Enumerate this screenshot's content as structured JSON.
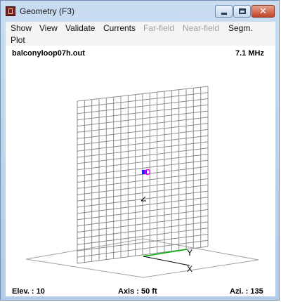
{
  "window": {
    "title": "Geometry   (F3)"
  },
  "menu": {
    "row1": [
      {
        "label": "Show",
        "disabled": false
      },
      {
        "label": "View",
        "disabled": false
      },
      {
        "label": "Validate",
        "disabled": false
      },
      {
        "label": "Currents",
        "disabled": false
      },
      {
        "label": "Far-field",
        "disabled": true
      },
      {
        "label": "Near-field",
        "disabled": true
      },
      {
        "label": "Segm.",
        "disabled": false
      }
    ],
    "row2": [
      {
        "label": "Plot",
        "disabled": false
      }
    ]
  },
  "view": {
    "filename": "balconyloop07h.out",
    "frequency": "7.1 MHz",
    "elevation": "Elev. : 10",
    "axis": "Axis : 50 ft",
    "azimuth": "Azi. : 135",
    "axes_labels": {
      "y": "Y",
      "x": "X"
    }
  },
  "colors": {
    "wire": "#8c8c8c",
    "source": "#2020ff",
    "load": "#ff00ff",
    "y_axis": "#00b000",
    "ground": "#a0a0a0"
  }
}
